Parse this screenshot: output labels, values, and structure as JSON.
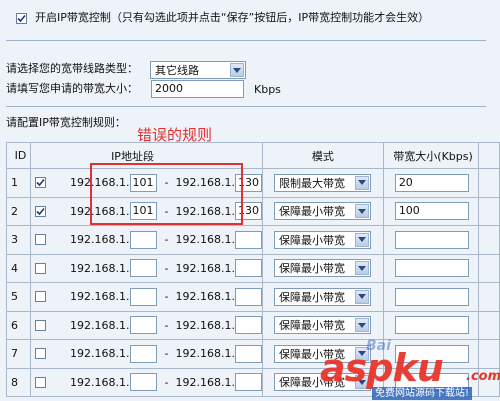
{
  "enable_control": {
    "checked": true,
    "label": "开启IP带宽控制（只有勾选此项并点击“保存”按钮后，IP带宽控制功能才会生效）"
  },
  "line_type": {
    "label": "请选择您的宽带线路类型：",
    "selected": "其它线路"
  },
  "bandwidth": {
    "label": "请填写您申请的带宽大小：",
    "value": "2000",
    "unit": "Kbps"
  },
  "rules_label": "请配置IP带宽控制规则：",
  "annotation": "错误的规则",
  "table": {
    "headers": {
      "id": "ID",
      "ip": "IP地址段",
      "mode": "模式",
      "bw": "带宽大小(Kbps)"
    },
    "ip_prefix": "192.168.1.",
    "dash": "-",
    "rows": [
      {
        "id": "1",
        "checked": true,
        "start": "101",
        "end": "130",
        "mode": "限制最大带宽",
        "bw": "20"
      },
      {
        "id": "2",
        "checked": true,
        "start": "101",
        "end": "130",
        "mode": "保障最小带宽",
        "bw": "100"
      },
      {
        "id": "3",
        "checked": false,
        "start": "",
        "end": "",
        "mode": "保障最小带宽",
        "bw": ""
      },
      {
        "id": "4",
        "checked": false,
        "start": "",
        "end": "",
        "mode": "保障最小带宽",
        "bw": ""
      },
      {
        "id": "5",
        "checked": false,
        "start": "",
        "end": "",
        "mode": "保障最小带宽",
        "bw": ""
      },
      {
        "id": "6",
        "checked": false,
        "start": "",
        "end": "",
        "mode": "保障最小带宽",
        "bw": ""
      },
      {
        "id": "7",
        "checked": false,
        "start": "",
        "end": "",
        "mode": "保障最小带宽",
        "bw": ""
      },
      {
        "id": "8",
        "checked": false,
        "start": "",
        "end": "",
        "mode": "保障最小带宽",
        "bw": ""
      }
    ]
  },
  "watermark": {
    "logo": "aspku",
    "logo_tld": ".com",
    "baidu": "Bai",
    "slogan": "免费网站源码下载站!"
  },
  "colors": {
    "background": "#eef3f9",
    "annotation_red": "#e03232",
    "watermark_red": "#e8352c",
    "watermark_blue": "#2b63b8"
  }
}
